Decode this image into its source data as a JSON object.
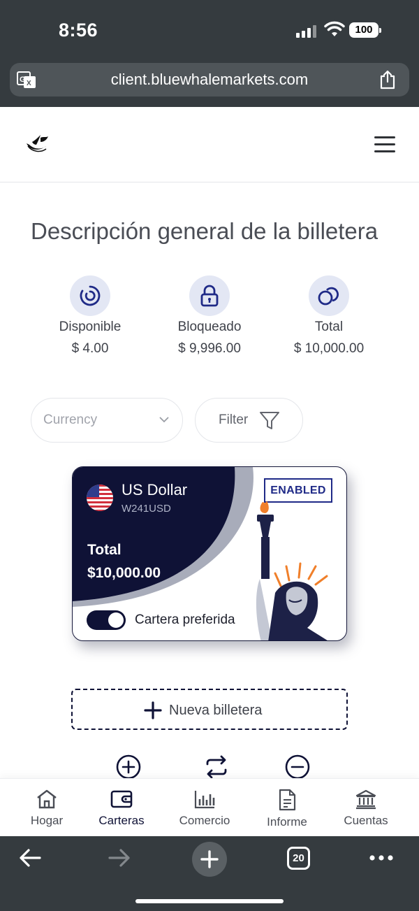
{
  "status_bar": {
    "time": "8:56",
    "battery": "100"
  },
  "browser": {
    "url": "client.bluewhalemarkets.com",
    "tab_count": "20"
  },
  "page": {
    "title": "Descripción general de la billetera"
  },
  "balances": [
    {
      "label": "Disponible",
      "value": "$ 4.00"
    },
    {
      "label": "Bloqueado",
      "value": "$ 9,996.00"
    },
    {
      "label": "Total",
      "value": "$ 10,000.00"
    }
  ],
  "filters": {
    "currency_placeholder": "Currency",
    "filter_label": "Filter"
  },
  "wallet_card": {
    "currency_name": "US Dollar",
    "wallet_code": "W241USD",
    "status": "ENABLED",
    "total_label": "Total",
    "total_value": "$10,000.00",
    "preferred_label": "Cartera preferida",
    "preferred_enabled": true
  },
  "new_wallet_label": "Nueva billetera",
  "app_nav": [
    {
      "label": "Hogar",
      "icon": "home-icon"
    },
    {
      "label": "Carteras",
      "icon": "wallet-icon",
      "active": true
    },
    {
      "label": "Comercio",
      "icon": "bar-chart-icon"
    },
    {
      "label": "Informe",
      "icon": "report-icon"
    },
    {
      "label": "Cuentas",
      "icon": "bank-icon"
    }
  ],
  "colors": {
    "navy": "#0f1236",
    "accent_blue": "#1f2a87",
    "icon_bg": "#e3e7f4",
    "browser_chrome": "#353b3f"
  }
}
